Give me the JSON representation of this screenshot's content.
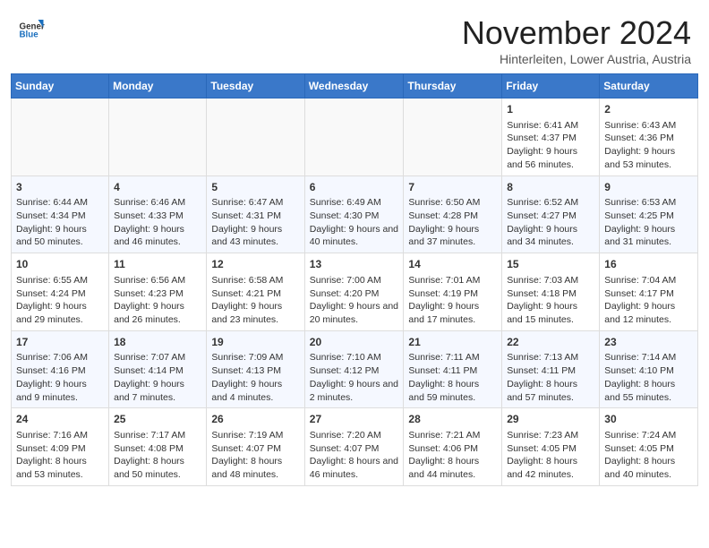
{
  "logo": {
    "general": "General",
    "blue": "Blue"
  },
  "header": {
    "month": "November 2024",
    "location": "Hinterleiten, Lower Austria, Austria"
  },
  "weekdays": [
    "Sunday",
    "Monday",
    "Tuesday",
    "Wednesday",
    "Thursday",
    "Friday",
    "Saturday"
  ],
  "weeks": [
    [
      {
        "day": "",
        "info": ""
      },
      {
        "day": "",
        "info": ""
      },
      {
        "day": "",
        "info": ""
      },
      {
        "day": "",
        "info": ""
      },
      {
        "day": "",
        "info": ""
      },
      {
        "day": "1",
        "info": "Sunrise: 6:41 AM\nSunset: 4:37 PM\nDaylight: 9 hours and 56 minutes."
      },
      {
        "day": "2",
        "info": "Sunrise: 6:43 AM\nSunset: 4:36 PM\nDaylight: 9 hours and 53 minutes."
      }
    ],
    [
      {
        "day": "3",
        "info": "Sunrise: 6:44 AM\nSunset: 4:34 PM\nDaylight: 9 hours and 50 minutes."
      },
      {
        "day": "4",
        "info": "Sunrise: 6:46 AM\nSunset: 4:33 PM\nDaylight: 9 hours and 46 minutes."
      },
      {
        "day": "5",
        "info": "Sunrise: 6:47 AM\nSunset: 4:31 PM\nDaylight: 9 hours and 43 minutes."
      },
      {
        "day": "6",
        "info": "Sunrise: 6:49 AM\nSunset: 4:30 PM\nDaylight: 9 hours and 40 minutes."
      },
      {
        "day": "7",
        "info": "Sunrise: 6:50 AM\nSunset: 4:28 PM\nDaylight: 9 hours and 37 minutes."
      },
      {
        "day": "8",
        "info": "Sunrise: 6:52 AM\nSunset: 4:27 PM\nDaylight: 9 hours and 34 minutes."
      },
      {
        "day": "9",
        "info": "Sunrise: 6:53 AM\nSunset: 4:25 PM\nDaylight: 9 hours and 31 minutes."
      }
    ],
    [
      {
        "day": "10",
        "info": "Sunrise: 6:55 AM\nSunset: 4:24 PM\nDaylight: 9 hours and 29 minutes."
      },
      {
        "day": "11",
        "info": "Sunrise: 6:56 AM\nSunset: 4:23 PM\nDaylight: 9 hours and 26 minutes."
      },
      {
        "day": "12",
        "info": "Sunrise: 6:58 AM\nSunset: 4:21 PM\nDaylight: 9 hours and 23 minutes."
      },
      {
        "day": "13",
        "info": "Sunrise: 7:00 AM\nSunset: 4:20 PM\nDaylight: 9 hours and 20 minutes."
      },
      {
        "day": "14",
        "info": "Sunrise: 7:01 AM\nSunset: 4:19 PM\nDaylight: 9 hours and 17 minutes."
      },
      {
        "day": "15",
        "info": "Sunrise: 7:03 AM\nSunset: 4:18 PM\nDaylight: 9 hours and 15 minutes."
      },
      {
        "day": "16",
        "info": "Sunrise: 7:04 AM\nSunset: 4:17 PM\nDaylight: 9 hours and 12 minutes."
      }
    ],
    [
      {
        "day": "17",
        "info": "Sunrise: 7:06 AM\nSunset: 4:16 PM\nDaylight: 9 hours and 9 minutes."
      },
      {
        "day": "18",
        "info": "Sunrise: 7:07 AM\nSunset: 4:14 PM\nDaylight: 9 hours and 7 minutes."
      },
      {
        "day": "19",
        "info": "Sunrise: 7:09 AM\nSunset: 4:13 PM\nDaylight: 9 hours and 4 minutes."
      },
      {
        "day": "20",
        "info": "Sunrise: 7:10 AM\nSunset: 4:12 PM\nDaylight: 9 hours and 2 minutes."
      },
      {
        "day": "21",
        "info": "Sunrise: 7:11 AM\nSunset: 4:11 PM\nDaylight: 8 hours and 59 minutes."
      },
      {
        "day": "22",
        "info": "Sunrise: 7:13 AM\nSunset: 4:11 PM\nDaylight: 8 hours and 57 minutes."
      },
      {
        "day": "23",
        "info": "Sunrise: 7:14 AM\nSunset: 4:10 PM\nDaylight: 8 hours and 55 minutes."
      }
    ],
    [
      {
        "day": "24",
        "info": "Sunrise: 7:16 AM\nSunset: 4:09 PM\nDaylight: 8 hours and 53 minutes."
      },
      {
        "day": "25",
        "info": "Sunrise: 7:17 AM\nSunset: 4:08 PM\nDaylight: 8 hours and 50 minutes."
      },
      {
        "day": "26",
        "info": "Sunrise: 7:19 AM\nSunset: 4:07 PM\nDaylight: 8 hours and 48 minutes."
      },
      {
        "day": "27",
        "info": "Sunrise: 7:20 AM\nSunset: 4:07 PM\nDaylight: 8 hours and 46 minutes."
      },
      {
        "day": "28",
        "info": "Sunrise: 7:21 AM\nSunset: 4:06 PM\nDaylight: 8 hours and 44 minutes."
      },
      {
        "day": "29",
        "info": "Sunrise: 7:23 AM\nSunset: 4:05 PM\nDaylight: 8 hours and 42 minutes."
      },
      {
        "day": "30",
        "info": "Sunrise: 7:24 AM\nSunset: 4:05 PM\nDaylight: 8 hours and 40 minutes."
      }
    ]
  ]
}
